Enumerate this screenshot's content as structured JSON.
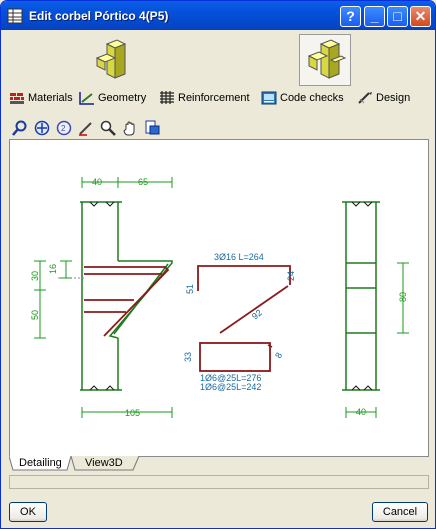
{
  "window": {
    "title": "Edit corbel Pórtico 4(P5)"
  },
  "titlebar_buttons": {
    "help": "?",
    "minimize": "_",
    "maximize": "□",
    "close": "✕"
  },
  "tabs": [
    {
      "label": "Materials",
      "icon": "materials-icon"
    },
    {
      "label": "Geometry",
      "icon": "geometry-icon"
    },
    {
      "label": "Reinforcement",
      "icon": "reinforcement-icon"
    },
    {
      "label": "Code checks",
      "icon": "code-checks-icon"
    },
    {
      "label": "Design",
      "icon": "design-icon"
    }
  ],
  "drawing": {
    "dim_top_left": "40",
    "dim_top_right": "65",
    "dim_16": "16",
    "dim_30": "30",
    "dim_50": "50",
    "dim_105": "105",
    "rebar_top": "3Ø16 L=264",
    "dim_24": "24",
    "dim_51": "51",
    "dim_92": "92",
    "dim_33": "33",
    "dim_8": "8",
    "stirrup_1": "1Ø6@25L=276",
    "stirrup_2": "1Ø6@25L=242",
    "dim_80": "80",
    "dim_40_right": "40"
  },
  "bottom_tabs": {
    "detailing": "Detailing",
    "view3d": "View3D"
  },
  "buttons": {
    "ok": "OK",
    "cancel": "Cancel"
  },
  "colors": {
    "rebar": "#8b1a1a",
    "concrete": "#1e7a1e",
    "dimension": "#1a9a1a",
    "label": "#1a6aa0"
  }
}
